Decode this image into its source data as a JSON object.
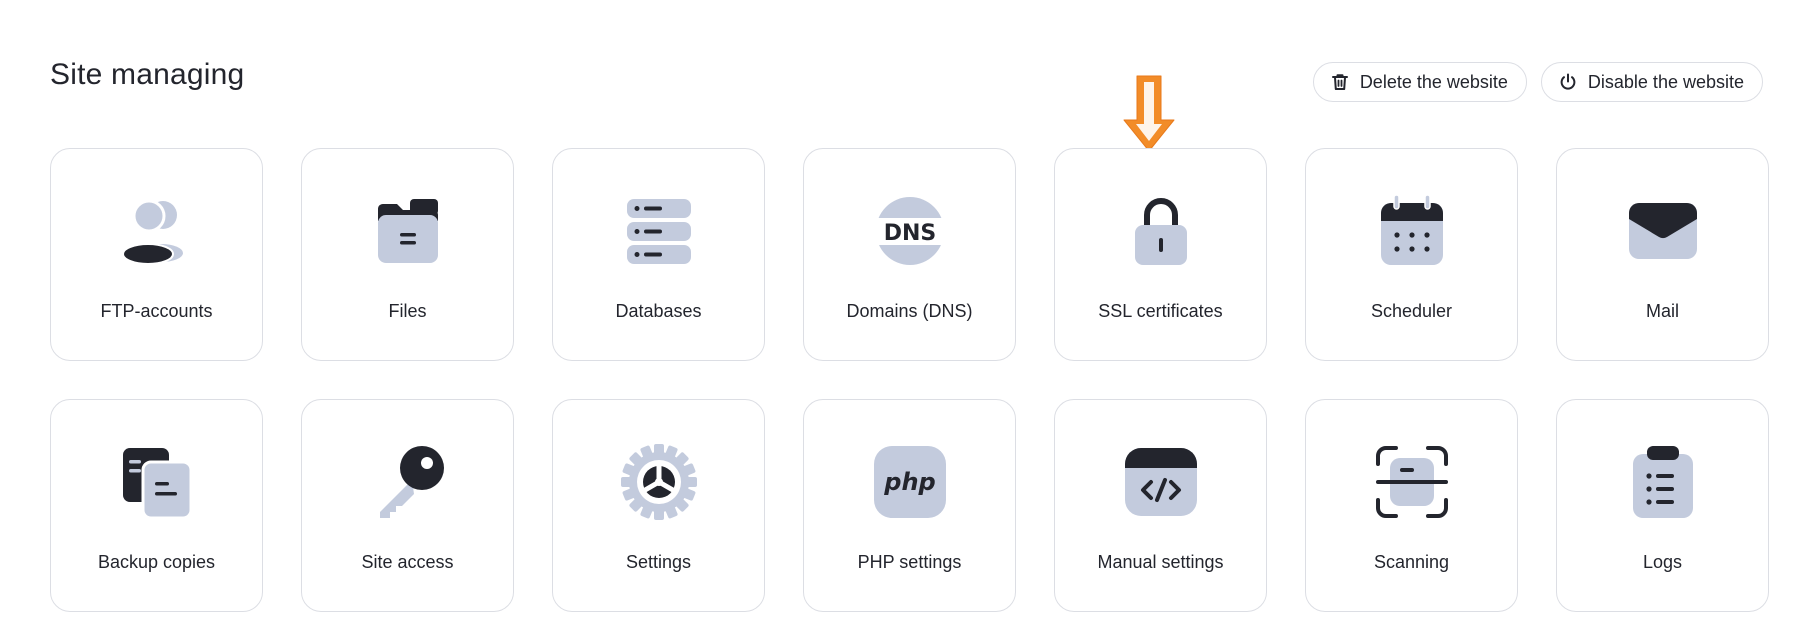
{
  "header": {
    "title": "Site managing",
    "delete_label": "Delete the website",
    "disable_label": "Disable the website"
  },
  "colors": {
    "icon_light": "#c3cbdd",
    "icon_dark": "#23252d",
    "accent_arrow": "#f28c28",
    "border": "#dcdee4"
  },
  "tiles": [
    {
      "label": "FTP-accounts",
      "icon": "users-icon"
    },
    {
      "label": "Files",
      "icon": "folder-icon"
    },
    {
      "label": "Databases",
      "icon": "database-icon"
    },
    {
      "label": "Domains (DNS)",
      "icon": "dns-icon",
      "icon_text": "DNS"
    },
    {
      "label": "SSL certificates",
      "icon": "lock-icon"
    },
    {
      "label": "Scheduler",
      "icon": "calendar-icon"
    },
    {
      "label": "Mail",
      "icon": "mail-icon"
    },
    {
      "label": "Backup copies",
      "icon": "copy-icon"
    },
    {
      "label": "Site access",
      "icon": "key-icon"
    },
    {
      "label": "Settings",
      "icon": "gear-icon"
    },
    {
      "label": "PHP settings",
      "icon": "php-icon",
      "icon_text": "php"
    },
    {
      "label": "Manual settings",
      "icon": "code-icon"
    },
    {
      "label": "Scanning",
      "icon": "scan-icon"
    },
    {
      "label": "Logs",
      "icon": "clipboard-list-icon"
    }
  ]
}
